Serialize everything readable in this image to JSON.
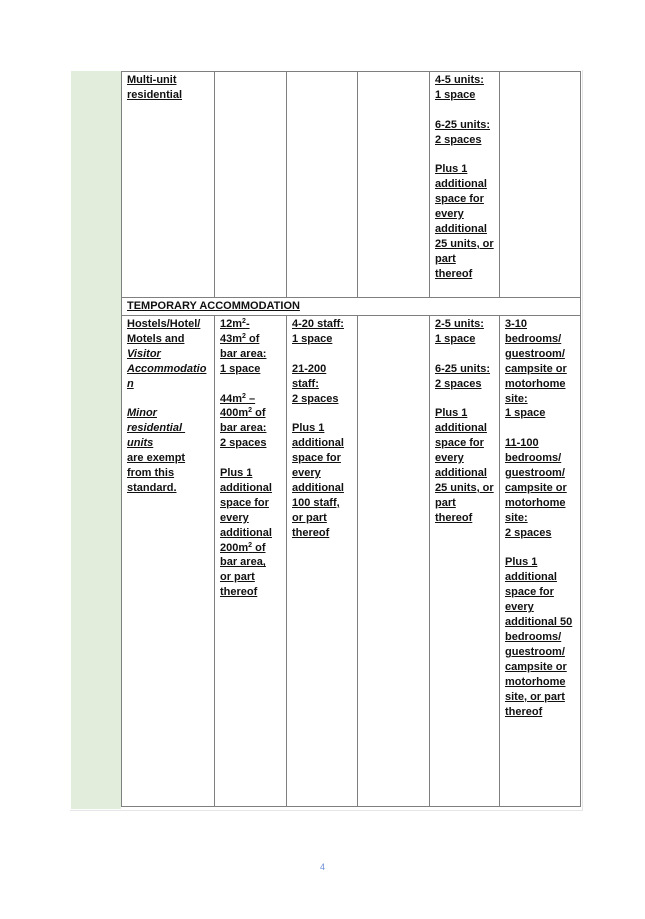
{
  "table": {
    "rows": [
      {
        "type": "data",
        "cells": [
          {
            "lines": [
              "Multi-unit",
              "residential"
            ]
          },
          {
            "lines": []
          },
          {
            "lines": []
          },
          {
            "lines": []
          },
          {
            "lines": [
              "4-5 units:",
              "1 space",
              "",
              "6-25 units:",
              "2 spaces",
              "",
              "Plus 1",
              "additional",
              "space for",
              "every",
              "additional",
              "25 units, or",
              "part",
              "thereof"
            ]
          },
          {
            "lines": []
          }
        ]
      },
      {
        "type": "heading",
        "label": "TEMPORARY ACCOMMODATION"
      },
      {
        "type": "data",
        "cells": [
          {
            "lines": [
              "Hostels/Hotel/",
              "Motels and",
              "Visitor",
              "Accommodatio",
              "n",
              "",
              "Minor",
              "residential units",
              "are exempt",
              "from this",
              "standard."
            ]
          },
          {
            "lines": [
              "12m²-",
              "43m² of",
              "bar area:",
              "1 space",
              "",
              "44m² –",
              "400m² of",
              "bar area:",
              "2 spaces",
              "",
              "Plus 1",
              "additional",
              "space for",
              "every",
              "additional",
              "200m² of",
              "bar area,",
              "or part",
              "thereof"
            ]
          },
          {
            "lines": [
              "4-20 staff:",
              "1 space",
              "",
              "21-200",
              "staff:",
              "2 spaces",
              "",
              "Plus 1",
              "additional",
              "space for",
              "every",
              "additional",
              "100 staff,",
              "or part",
              "thereof"
            ]
          },
          {
            "lines": []
          },
          {
            "lines": [
              "2-5 units:",
              "1 space",
              "",
              "6-25 units:",
              "2 spaces",
              "",
              "Plus 1",
              "additional",
              "space for",
              "every",
              "additional",
              "25 units, or",
              "part",
              "thereof"
            ]
          },
          {
            "lines": [
              "3-10",
              "bedrooms/",
              "guestroom/",
              "campsite or",
              "motorhome",
              "site:",
              "1 space",
              "",
              "11-100",
              "bedrooms/",
              "guestroom/",
              "campsite or",
              "motorhome",
              "site:",
              "2 spaces",
              "",
              "Plus 1",
              "additional",
              "space for",
              "every",
              "additional 50",
              "bedrooms/",
              "guestroom/",
              "campsite or",
              "motorhome",
              "site, or part",
              "thereof"
            ]
          }
        ]
      }
    ]
  },
  "page_number": "4",
  "colors": {
    "sidebar_green": "#e2eedb",
    "border_gray": "#7f7f7f",
    "page_number_blue": "#6b8fd6"
  }
}
